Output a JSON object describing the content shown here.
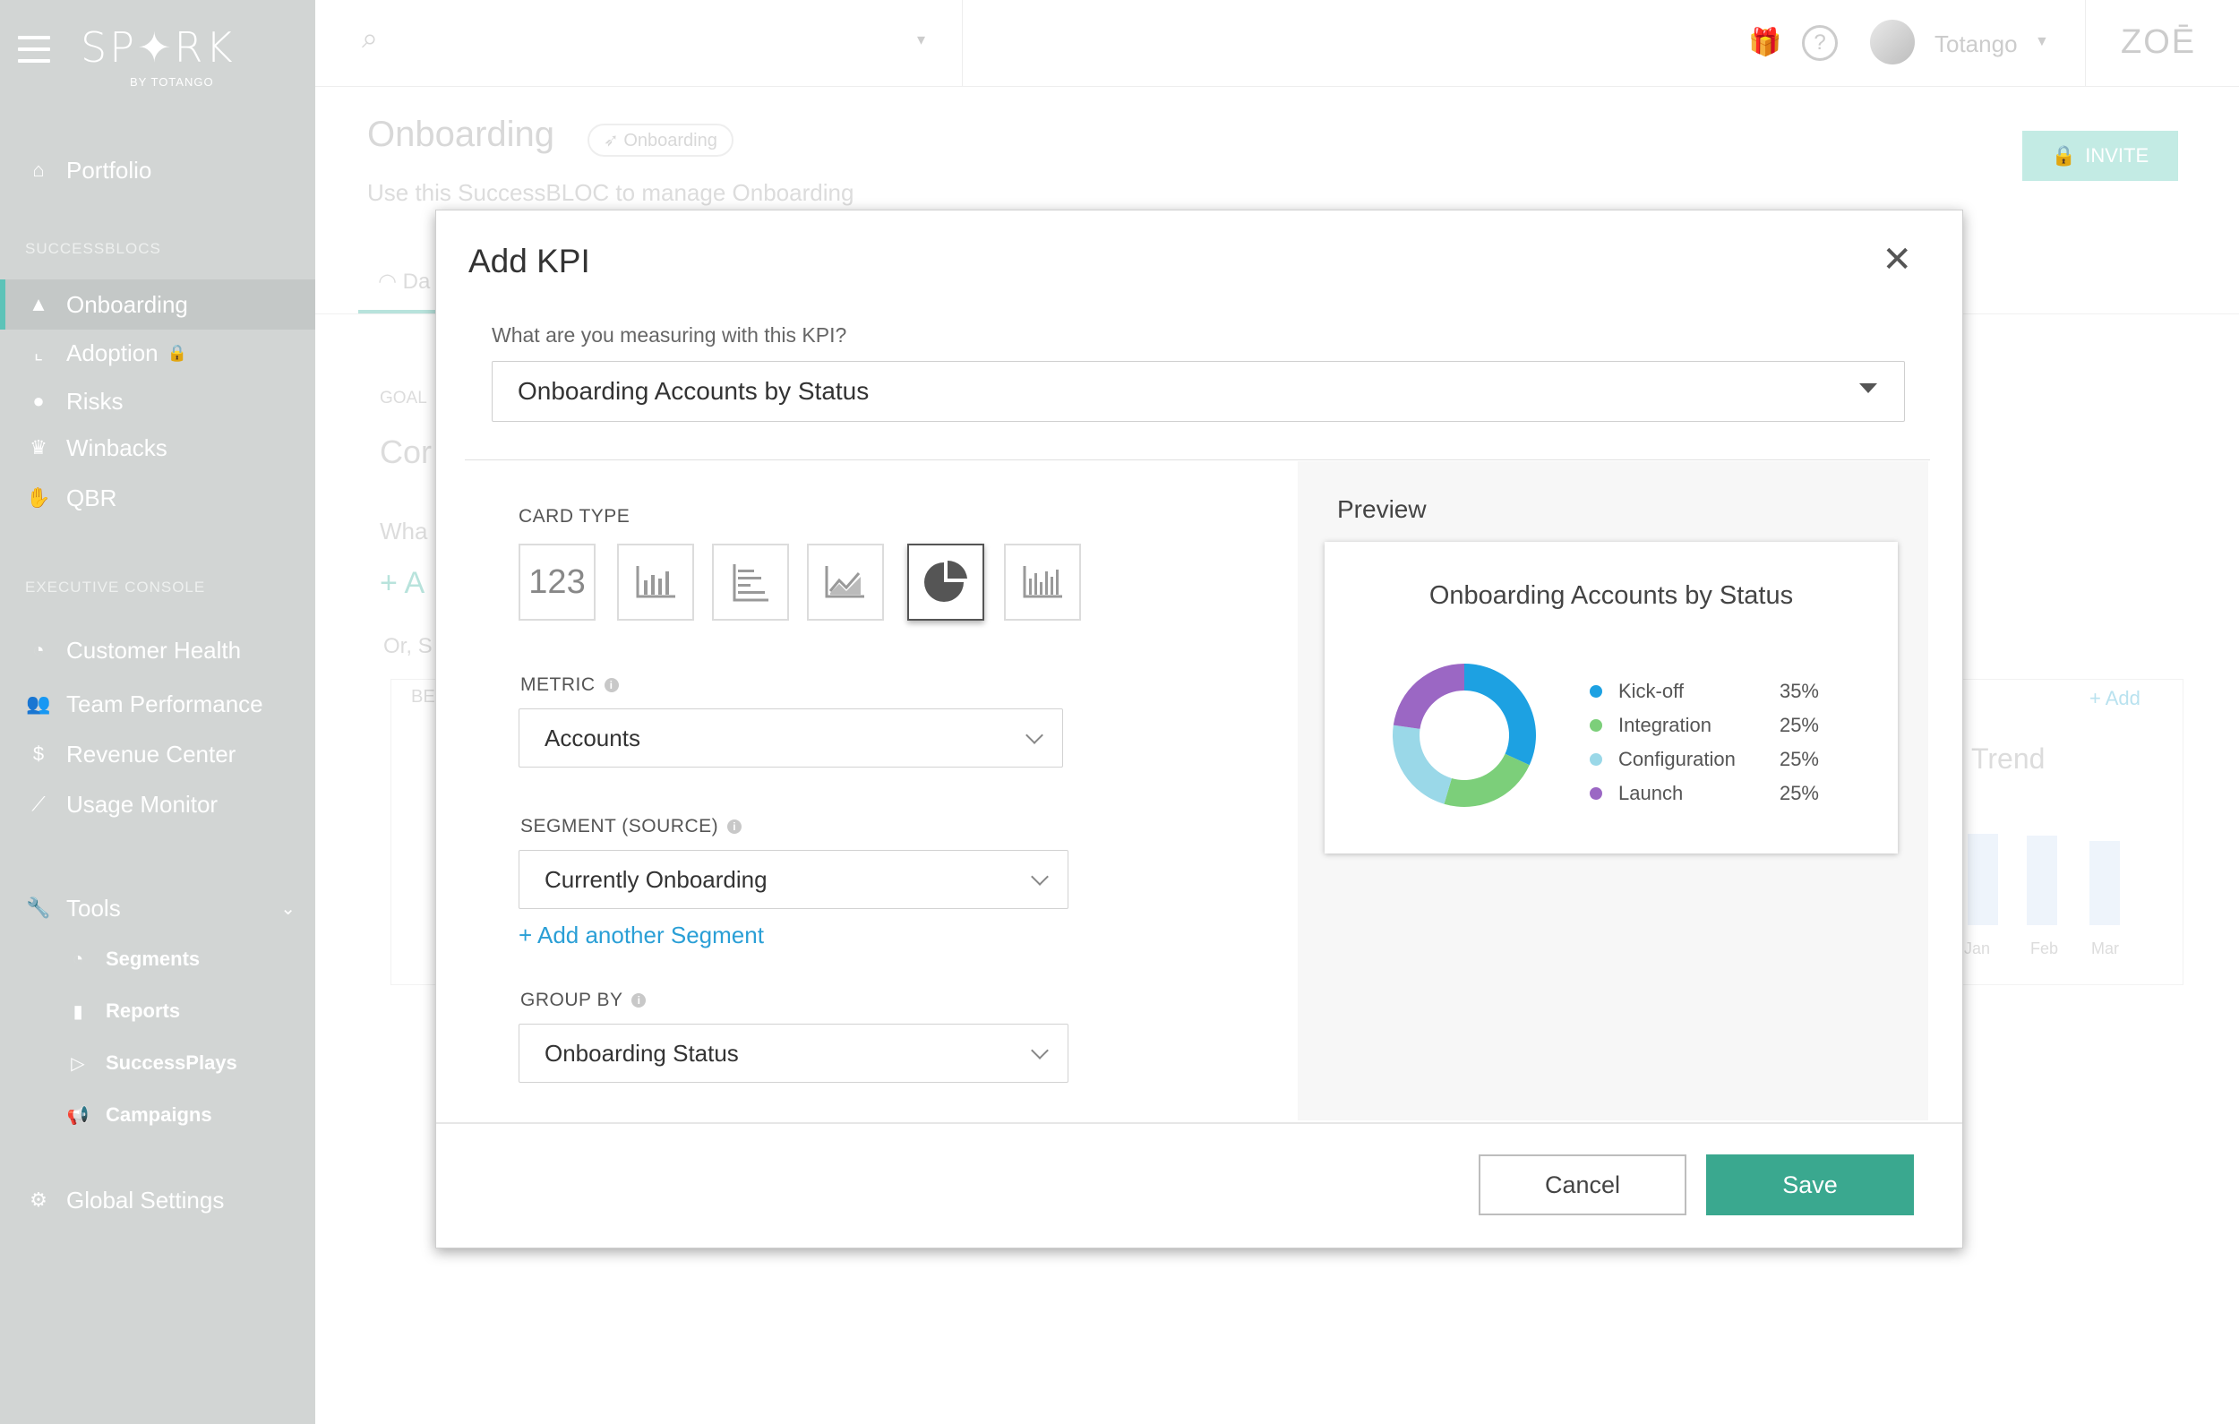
{
  "sidebar": {
    "logo": "SP✦RK",
    "logo_sub": "BY TOTANGO",
    "portfolio": "Portfolio",
    "section_successblocs": "SUCCESSBLOCS",
    "blocs": [
      {
        "label": "Onboarding",
        "icon": "rocket-icon"
      },
      {
        "label": "Adoption",
        "icon": "chart-icon"
      },
      {
        "label": "Risks",
        "icon": "bomb-icon"
      },
      {
        "label": "Winbacks",
        "icon": "trophy-icon"
      },
      {
        "label": "QBR",
        "icon": "handshake-icon"
      }
    ],
    "section_exec": "EXECUTIVE CONSOLE",
    "exec": [
      {
        "label": "Customer Health",
        "icon": "health-icon"
      },
      {
        "label": "Team Performance",
        "icon": "team-icon"
      },
      {
        "label": "Revenue Center",
        "icon": "dollar-icon"
      },
      {
        "label": "Usage Monitor",
        "icon": "line-chart-icon"
      }
    ],
    "tools": "Tools",
    "tools_items": [
      {
        "label": "Segments",
        "icon": "pie-icon"
      },
      {
        "label": "Reports",
        "icon": "bar-chart-icon"
      },
      {
        "label": "SuccessPlays",
        "icon": "play-icon"
      },
      {
        "label": "Campaigns",
        "icon": "megaphone-icon"
      }
    ],
    "global_settings": "Global Settings"
  },
  "topbar": {
    "user_name": "Totango",
    "brand": "ZOĒ"
  },
  "page": {
    "title": "Onboarding",
    "pill": "Onboarding",
    "description": "Use this SuccessBLOC to manage Onboarding",
    "invite": "INVITE",
    "tab": "Da",
    "goal": "GOAL",
    "con": "Cor",
    "what": "Wha",
    "add_a": "A",
    "or_s": "Or, S",
    "be": "BE",
    "add": "Add",
    "trend": "Trend",
    "months": [
      "Jan",
      "Feb",
      "Mar"
    ]
  },
  "modal": {
    "title": "Add KPI",
    "question": "What are you measuring with this KPI?",
    "kpi_value": "Onboarding Accounts by Status",
    "card_type_label": "CARD TYPE",
    "card_types": [
      "number",
      "bar",
      "horizontal-bar",
      "line",
      "pie",
      "histogram"
    ],
    "card_number_text": "123",
    "metric_label": "METRIC",
    "metric_value": "Accounts",
    "segment_label": "SEGMENT (SOURCE)",
    "segment_value": "Currently Onboarding",
    "add_segment": "+ Add another Segment",
    "group_by_label": "GROUP BY",
    "group_by_value": "Onboarding Status",
    "preview_label": "Preview",
    "cancel": "Cancel",
    "save": "Save"
  },
  "chart_data": {
    "type": "pie",
    "title": "Onboarding Accounts by Status",
    "categories": [
      "Kick-off",
      "Integration",
      "Configuration",
      "Launch"
    ],
    "labels": [
      "35%",
      "25%",
      "25%",
      "25%"
    ],
    "values": [
      35,
      25,
      25,
      25
    ],
    "colors": [
      "#1da1e2",
      "#7ccf7a",
      "#9ad8e8",
      "#9b67c4"
    ],
    "legend_position": "right"
  },
  "colors": {
    "accent": "#3aa88f",
    "link": "#2a9fd6",
    "sidebar": "#d2d5d4"
  }
}
